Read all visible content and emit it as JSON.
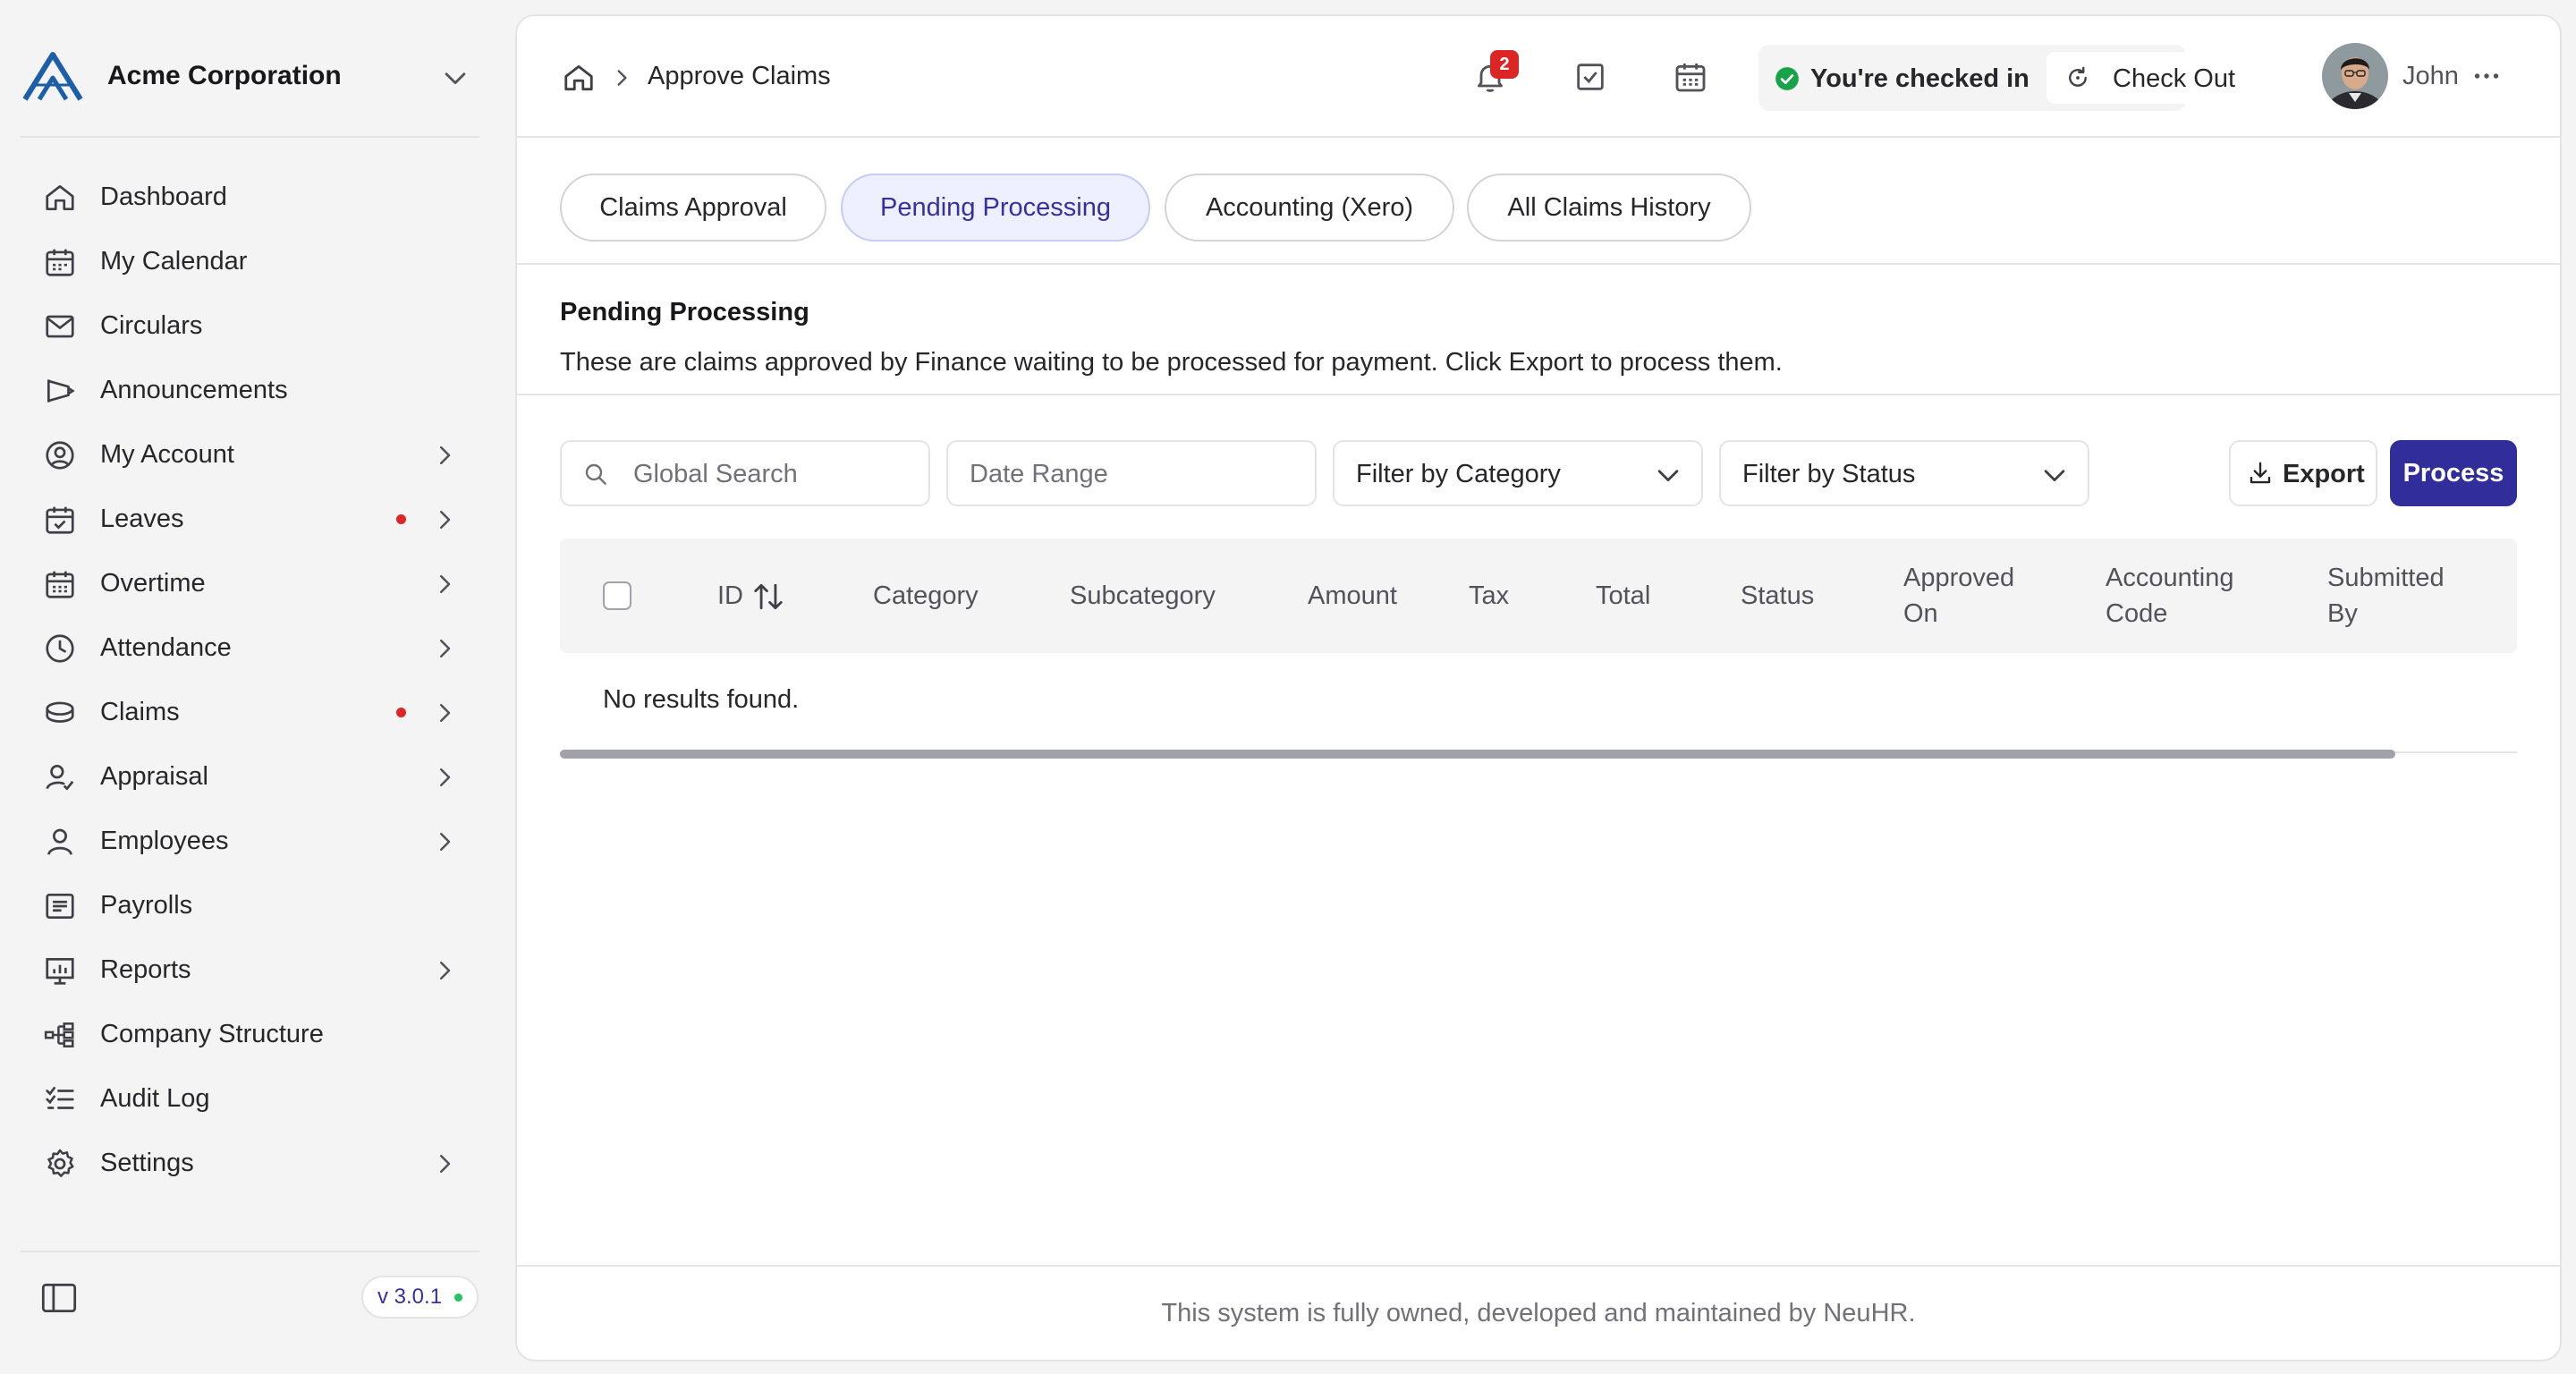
{
  "brand": {
    "name": "Acme Corporation",
    "logo_icon": "acme-logo",
    "accent": "#1d5fa7"
  },
  "sidebar": {
    "items": [
      {
        "label": "Dashboard",
        "icon": "home-icon",
        "chevron": false,
        "dot": false
      },
      {
        "label": "My Calendar",
        "icon": "calendar-icon",
        "chevron": false,
        "dot": false
      },
      {
        "label": "Circulars",
        "icon": "mail-icon",
        "chevron": false,
        "dot": false
      },
      {
        "label": "Announcements",
        "icon": "megaphone-icon",
        "chevron": false,
        "dot": false
      },
      {
        "label": "My Account",
        "icon": "user-circle-icon",
        "chevron": true,
        "dot": false
      },
      {
        "label": "Leaves",
        "icon": "calendar-check-icon",
        "chevron": true,
        "dot": true
      },
      {
        "label": "Overtime",
        "icon": "calendar-grid-icon",
        "chevron": true,
        "dot": false
      },
      {
        "label": "Attendance",
        "icon": "clock-icon",
        "chevron": true,
        "dot": false
      },
      {
        "label": "Claims",
        "icon": "coins-icon",
        "chevron": true,
        "dot": true
      },
      {
        "label": "Appraisal",
        "icon": "user-check-icon",
        "chevron": true,
        "dot": false
      },
      {
        "label": "Employees",
        "icon": "user-icon",
        "chevron": true,
        "dot": false
      },
      {
        "label": "Payrolls",
        "icon": "receipt-icon",
        "chevron": false,
        "dot": false
      },
      {
        "label": "Reports",
        "icon": "presentation-chart-icon",
        "chevron": true,
        "dot": false
      },
      {
        "label": "Company Structure",
        "icon": "hierarchy-icon",
        "chevron": false,
        "dot": false
      },
      {
        "label": "Audit Log",
        "icon": "checklist-icon",
        "chevron": false,
        "dot": false
      },
      {
        "label": "Settings",
        "icon": "gear-icon",
        "chevron": true,
        "dot": false
      }
    ],
    "version": "v 3.0.1",
    "toggle_icon": "sidebar-toggle-icon",
    "dot_color": "#dc2626"
  },
  "header": {
    "breadcrumb_current": "Approve Claims",
    "notification_count": "2",
    "checked_in_text": "You're checked in",
    "checkout_label": "Check Out",
    "user_name": "John"
  },
  "tabs": [
    {
      "label": "Claims Approval",
      "active": false
    },
    {
      "label": "Pending Processing",
      "active": true
    },
    {
      "label": "Accounting (Xero)",
      "active": false
    },
    {
      "label": "All Claims History",
      "active": false
    }
  ],
  "section": {
    "title": "Pending Processing",
    "description": "These are claims approved by Finance waiting to be processed for payment. Click Export to process them."
  },
  "filters": {
    "search_placeholder": "Global Search",
    "date_range_placeholder": "Date Range",
    "category_select": "Filter by Category",
    "status_select": "Filter by Status",
    "export_label": "Export",
    "process_label": "Process"
  },
  "table": {
    "columns": [
      "ID",
      "Category",
      "Subcategory",
      "Amount",
      "Tax",
      "Total",
      "Status",
      "Approved On",
      "Accounting Code",
      "Submitted By"
    ],
    "empty_text": "No results found."
  },
  "footer": {
    "text": "This system is fully owned, developed and maintained by NeuHR."
  },
  "colors": {
    "primary": "#312e9c",
    "active_tab_bg": "#eef0ff",
    "active_tab_text": "#3730a3",
    "success": "#16a34a",
    "badge": "#dc2626"
  }
}
